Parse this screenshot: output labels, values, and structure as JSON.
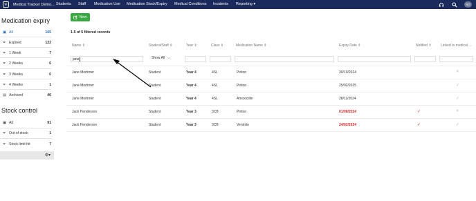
{
  "app": {
    "brand": "Medical Tracker Demo...",
    "nav": [
      "Students",
      "Staff",
      "Medication Use",
      "Medication Stock/Expiry",
      "Medical Conditions",
      "Incidents",
      "Reporting"
    ],
    "reporting_caret": "▾",
    "user_initials": "NG",
    "icons": [
      "logo-icon",
      "headset-icon",
      "search-icon"
    ]
  },
  "sidebar": {
    "expiry_heading": "Medication expiry",
    "expiry_items": [
      {
        "label": "All",
        "count": "165",
        "icon": "medkit-icon",
        "active": true
      },
      {
        "label": "Expired",
        "count": "122",
        "icon": "filter-icon"
      },
      {
        "label": "1 Week",
        "count": "7",
        "icon": "filter-icon"
      },
      {
        "label": "2 Weeks",
        "count": "6",
        "icon": "filter-icon"
      },
      {
        "label": "3 Weeks",
        "count": "0",
        "icon": "filter-icon"
      },
      {
        "label": "4 Weeks",
        "count": "1",
        "icon": "filter-icon"
      },
      {
        "label": "Archived",
        "count": "46",
        "icon": "archive-icon"
      }
    ],
    "stock_heading": "Stock control",
    "stock_items": [
      {
        "label": "All",
        "count": "91",
        "icon": "medkit-icon"
      },
      {
        "label": "Out of stock",
        "count": "1",
        "icon": "filter-icon"
      },
      {
        "label": "Stock limit hit",
        "count": "7",
        "icon": "filter-icon"
      }
    ],
    "footer_icon": "gear-icon"
  },
  "main": {
    "new_button": "New",
    "records_text": "1-5 of 5 filtered records",
    "columns": [
      "Name ⇕",
      "Student/Staff ⇕",
      "Year ⇕",
      "Class ⇕",
      "Medication Name ⇕",
      "Expiry Date ⇕",
      "Notified ⇕",
      "Linked to medical ..."
    ],
    "filter_name_value": "jane",
    "filter_type_value": "Show All",
    "rows": [
      {
        "name": "Jane Mortimer",
        "type": "Student",
        "year": "Year 4",
        "class": "4SL",
        "medication": "Piriton",
        "expiry": "30/10/2024",
        "expired": false,
        "notified": false,
        "linked": "x"
      },
      {
        "name": "Jane Mortimer",
        "type": "Student",
        "year": "Year 4",
        "class": "4SL",
        "medication": "Piriton",
        "expiry": "25/02/2025",
        "expired": false,
        "notified": false,
        "linked": "check"
      },
      {
        "name": "Jane Mortimer",
        "type": "Student",
        "year": "Year 4",
        "class": "4SL",
        "medication": "Amoxicillin",
        "expiry": "28/11/2024",
        "expired": false,
        "notified": false,
        "linked": "check"
      },
      {
        "name": "Jack Henderson",
        "type": "Student",
        "year": "Year 3",
        "class": "3CB",
        "medication": "Piriton",
        "expiry": "01/08/2024",
        "expired": true,
        "notified": true,
        "linked": "x"
      },
      {
        "name": "Jack Henderson",
        "type": "Student",
        "year": "Year 3",
        "class": "3CB",
        "medication": "Ventolin",
        "expiry": "24/02/2024",
        "expired": true,
        "notified": true,
        "linked": "check"
      }
    ]
  },
  "colors": {
    "nav_bg": "#1a2a5c",
    "accent": "#2b6cb0",
    "new_button": "#3aa843",
    "expired": "#d62828"
  }
}
